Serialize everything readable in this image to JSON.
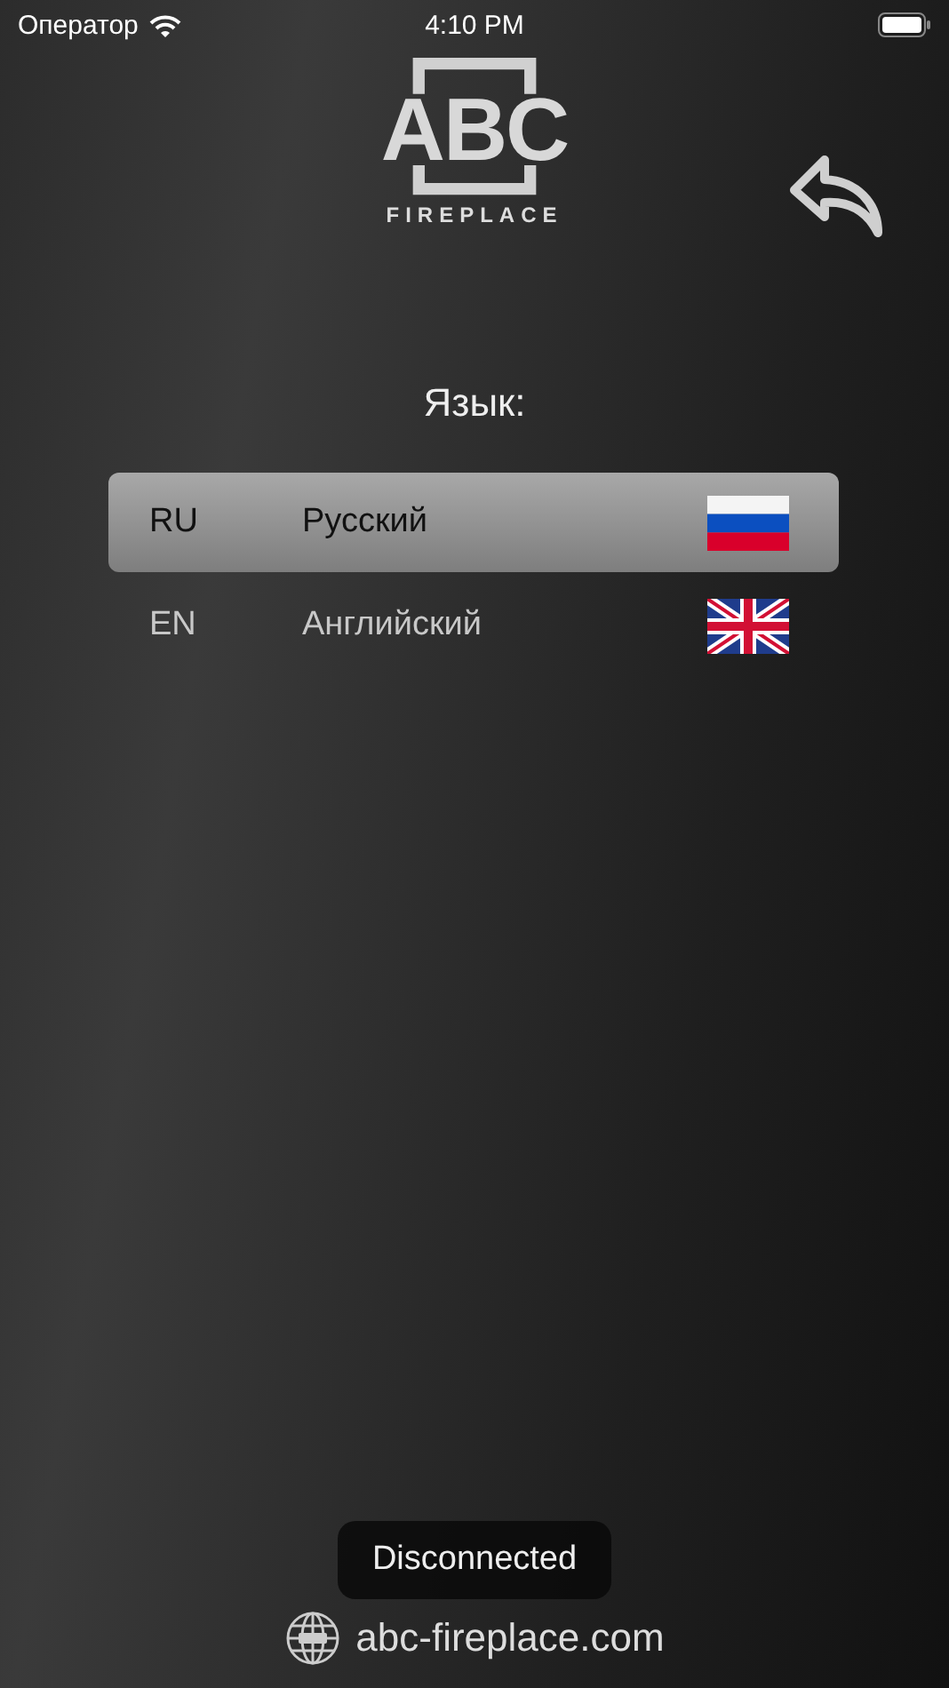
{
  "status_bar": {
    "carrier": "Оператор",
    "time": "4:10 PM"
  },
  "logo": {
    "mark": "ABC",
    "subtitle": "FIREPLACE"
  },
  "title": "Язык:",
  "languages": [
    {
      "code": "RU",
      "name": "Русский",
      "kind": "ru",
      "selected": true
    },
    {
      "code": "EN",
      "name": "Английский",
      "kind": "gb",
      "selected": false
    }
  ],
  "footer": {
    "website": "abc-fireplace.com"
  },
  "toast": {
    "message": "Disconnected"
  }
}
